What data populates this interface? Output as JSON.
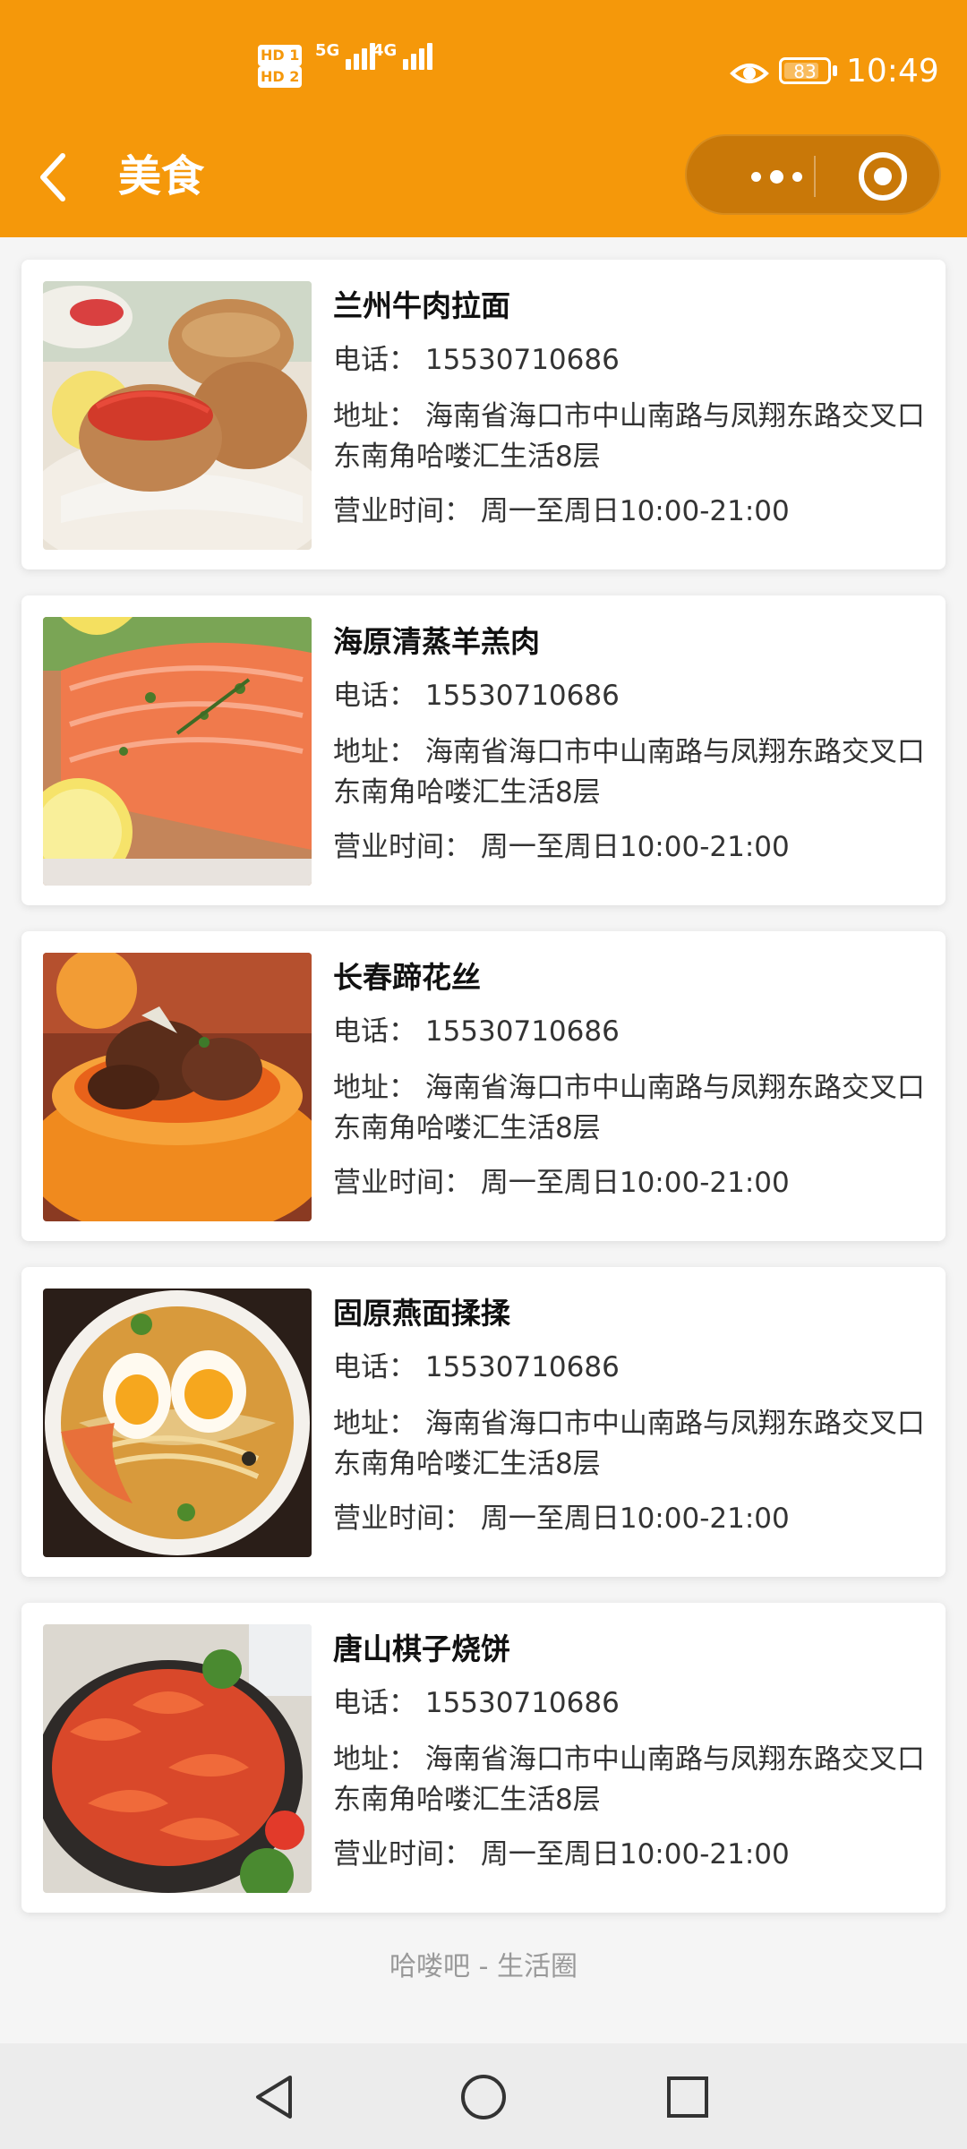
{
  "status_bar": {
    "hd_labels": [
      "HD 1",
      "HD 2"
    ],
    "signal_1": "5G",
    "signal_2": "4G",
    "battery": "83",
    "battery_level_percent": 83,
    "time": "10:49"
  },
  "nav": {
    "title": "美食",
    "back_icon": "chevron-left-icon",
    "more_icon": "more-dots-icon",
    "close_icon": "target-circle-icon"
  },
  "theme": {
    "accent": "#f5980a",
    "capsule": "#c97808"
  },
  "restaurants": [
    {
      "name": "兰州牛肉拉面",
      "phone": "电话：  15530710686",
      "address": "地址：  海南省海口市中山南路与凤翔东路交叉口东南角哈喽汇生活8层",
      "hours": "营业时间：  周一至周日10:00-21:00"
    },
    {
      "name": "海原清蒸羊羔肉",
      "phone": "电话：  15530710686",
      "address": "地址：  海南省海口市中山南路与凤翔东路交叉口东南角哈喽汇生活8层",
      "hours": "营业时间：  周一至周日10:00-21:00"
    },
    {
      "name": "长春蹄花丝",
      "phone": "电话：  15530710686",
      "address": "地址：  海南省海口市中山南路与凤翔东路交叉口东南角哈喽汇生活8层",
      "hours": "营业时间：  周一至周日10:00-21:00"
    },
    {
      "name": "固原燕面揉揉",
      "phone": "电话：  15530710686",
      "address": "地址：  海南省海口市中山南路与凤翔东路交叉口东南角哈喽汇生活8层",
      "hours": "营业时间：  周一至周日10:00-21:00"
    },
    {
      "name": "唐山棋子烧饼",
      "phone": "电话：  15530710686",
      "address": "地址：  海南省海口市中山南路与凤翔东路交叉口东南角哈喽汇生活8层",
      "hours": "营业时间：  周一至周日10:00-21:00"
    }
  ],
  "footer": "哈喽吧 - 生活圈",
  "system_nav": {
    "back_icon": "triangle-back-icon",
    "home_icon": "circle-home-icon",
    "recents_icon": "square-recents-icon"
  }
}
